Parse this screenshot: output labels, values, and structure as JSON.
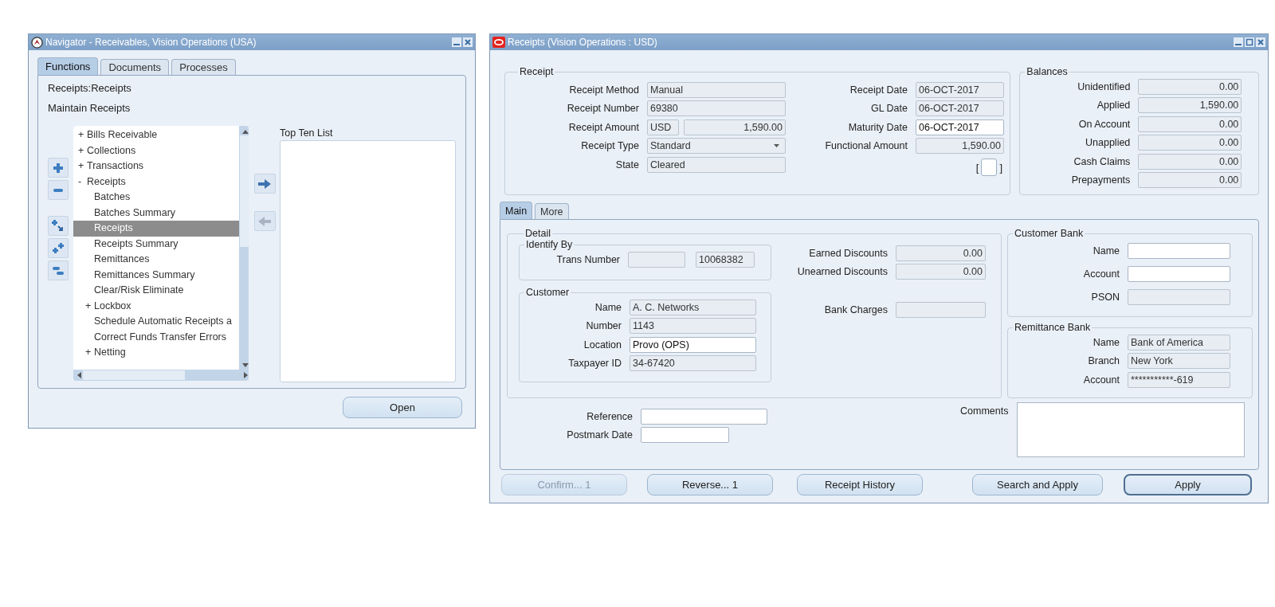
{
  "navigator": {
    "title": "Navigator - Receivables, Vision Operations (USA)",
    "tabs": [
      {
        "label": "Functions",
        "selected": true
      },
      {
        "label": "Documents",
        "selected": false
      },
      {
        "label": "Processes",
        "selected": false
      }
    ],
    "path": "Receipts:Receipts",
    "description": "Maintain Receipts",
    "tree": [
      {
        "marker": "+",
        "label": "Bills Receivable",
        "selected": false
      },
      {
        "marker": "+",
        "label": "Collections",
        "selected": false
      },
      {
        "marker": "+",
        "label": "Transactions",
        "selected": false
      },
      {
        "marker": "-",
        "label": "Receipts",
        "selected": false,
        "children": [
          {
            "label": "Batches",
            "selected": false
          },
          {
            "label": "Batches Summary",
            "selected": false
          },
          {
            "label": "Receipts",
            "selected": true
          },
          {
            "label": "Receipts Summary",
            "selected": false
          },
          {
            "label": "Remittances",
            "selected": false
          },
          {
            "label": "Remittances Summary",
            "selected": false
          },
          {
            "label": "Clear/Risk Eliminate",
            "selected": false
          },
          {
            "marker": "+",
            "label": "Lockbox",
            "selected": false
          },
          {
            "label": "Schedule Automatic Receipts a",
            "selected": false
          },
          {
            "label": "Correct Funds Transfer Errors",
            "selected": false
          },
          {
            "marker": "+",
            "label": "Netting",
            "selected": false
          }
        ]
      }
    ],
    "transfer_buttons": [
      {
        "disabled": false
      },
      {
        "disabled": true
      }
    ],
    "top_ten_label": "Top Ten List",
    "open_button": "Open"
  },
  "receipts": {
    "title": "Receipts (Vision Operations : USD)",
    "receipt": {
      "legend": "Receipt",
      "left_fields": [
        {
          "label": "Receipt Method",
          "inputs": [
            {
              "kind": "text",
              "editable": false,
              "value": "Manual"
            }
          ]
        },
        {
          "label": "Receipt Number",
          "inputs": [
            {
              "kind": "text",
              "editable": false,
              "value": "69380"
            }
          ]
        },
        {
          "label": "Receipt Amount",
          "inputs": [
            {
              "kind": "text",
              "editable": false,
              "value": "USD"
            },
            {
              "kind": "number",
              "editable": false,
              "value": "1,590.00"
            }
          ]
        },
        {
          "label": "Receipt Type",
          "inputs": [
            {
              "kind": "list",
              "editable": false,
              "value": "Standard"
            }
          ]
        },
        {
          "label": "State",
          "inputs": [
            {
              "kind": "text",
              "editable": false,
              "value": "Cleared"
            }
          ]
        }
      ],
      "right_fields": [
        {
          "label": "Receipt Date",
          "inputs": [
            {
              "kind": "text",
              "editable": false,
              "value": "06-OCT-2017"
            }
          ]
        },
        {
          "label": "GL Date",
          "inputs": [
            {
              "kind": "text",
              "editable": false,
              "value": "06-OCT-2017"
            }
          ]
        },
        {
          "label": "Maturity Date",
          "inputs": [
            {
              "kind": "text",
              "editable": true,
              "value": "06-OCT-2017"
            }
          ]
        },
        {
          "label": "Functional Amount",
          "inputs": [
            {
              "kind": "number",
              "editable": false,
              "value": "1,590.00"
            }
          ]
        }
      ],
      "checkbox": {
        "checked": false,
        "brackets": [
          "[",
          "]"
        ]
      }
    },
    "balances": {
      "legend": "Balances",
      "rows": [
        {
          "label": "Unidentified",
          "value": "0.00"
        },
        {
          "label": "Applied",
          "value": "1,590.00"
        },
        {
          "label": "On Account",
          "value": "0.00"
        },
        {
          "label": "Unapplied",
          "value": "0.00"
        },
        {
          "label": "Cash Claims",
          "value": "0.00"
        },
        {
          "label": "Prepayments",
          "value": "0.00"
        }
      ]
    },
    "tabs": [
      {
        "label": "Main",
        "selected": true
      },
      {
        "label": "More",
        "selected": false
      }
    ],
    "detail": {
      "legend": "Detail",
      "identify_by": {
        "legend": "Identify By",
        "fields": [
          {
            "label": "Trans Number",
            "inputs": [
              {
                "kind": "text",
                "editable": false
              },
              {
                "kind": "text",
                "editable": false,
                "value": "10068382"
              }
            ]
          }
        ]
      },
      "customer": {
        "legend": "Customer",
        "fields": [
          {
            "label": "Name",
            "inputs": [
              {
                "kind": "text",
                "editable": false,
                "value": "A. C. Networks"
              }
            ]
          },
          {
            "label": "Number",
            "inputs": [
              {
                "kind": "text",
                "editable": false,
                "value": "1143"
              }
            ]
          },
          {
            "label": "Location",
            "inputs": [
              {
                "kind": "text",
                "editable": true,
                "value": "Provo (OPS)"
              }
            ]
          },
          {
            "label": "Taxpayer ID",
            "inputs": [
              {
                "kind": "text",
                "editable": false,
                "value": "34-67420"
              }
            ]
          }
        ]
      },
      "amounts": [
        {
          "label": "Earned Discounts",
          "inputs": [
            {
              "kind": "number",
              "editable": false,
              "value": "0.00"
            }
          ]
        },
        {
          "label": "Unearned Discounts",
          "inputs": [
            {
              "kind": "number",
              "editable": false,
              "value": "0.00"
            }
          ]
        },
        {
          "label": "Bank Charges",
          "inputs": [
            {
              "kind": "number",
              "editable": false
            }
          ]
        }
      ]
    },
    "customer_bank": {
      "legend": "Customer Bank",
      "fields": [
        {
          "label": "Name",
          "inputs": [
            {
              "kind": "text",
              "editable": true
            }
          ]
        },
        {
          "label": "Account",
          "inputs": [
            {
              "kind": "text",
              "editable": true
            }
          ]
        },
        {
          "label": "PSON",
          "inputs": [
            {
              "kind": "text",
              "editable": false
            }
          ]
        }
      ]
    },
    "remittance_bank": {
      "legend": "Remittance Bank",
      "fields": [
        {
          "label": "Name",
          "inputs": [
            {
              "kind": "text",
              "editable": false,
              "value": "Bank of America"
            }
          ]
        },
        {
          "label": "Branch",
          "inputs": [
            {
              "kind": "text",
              "editable": false,
              "value": "New York"
            }
          ]
        },
        {
          "label": "Account",
          "inputs": [
            {
              "kind": "text",
              "editable": false,
              "value": "***********-619"
            }
          ]
        }
      ]
    },
    "bottom_fields": [
      {
        "label": "Reference",
        "inputs": [
          {
            "kind": "text",
            "editable": true
          }
        ]
      },
      {
        "label": "Postmark Date",
        "inputs": [
          {
            "kind": "text",
            "editable": true
          }
        ]
      }
    ],
    "comments_label": "Comments",
    "buttons": [
      {
        "label": "Confirm... 1",
        "disabled": true,
        "default": false
      },
      {
        "label": "Reverse... 1",
        "disabled": false,
        "default": false
      },
      {
        "label": "Receipt History",
        "disabled": false,
        "default": false
      },
      {
        "label": "Search and Apply",
        "disabled": false,
        "default": false
      },
      {
        "label": "Apply",
        "disabled": false,
        "default": true
      }
    ]
  }
}
